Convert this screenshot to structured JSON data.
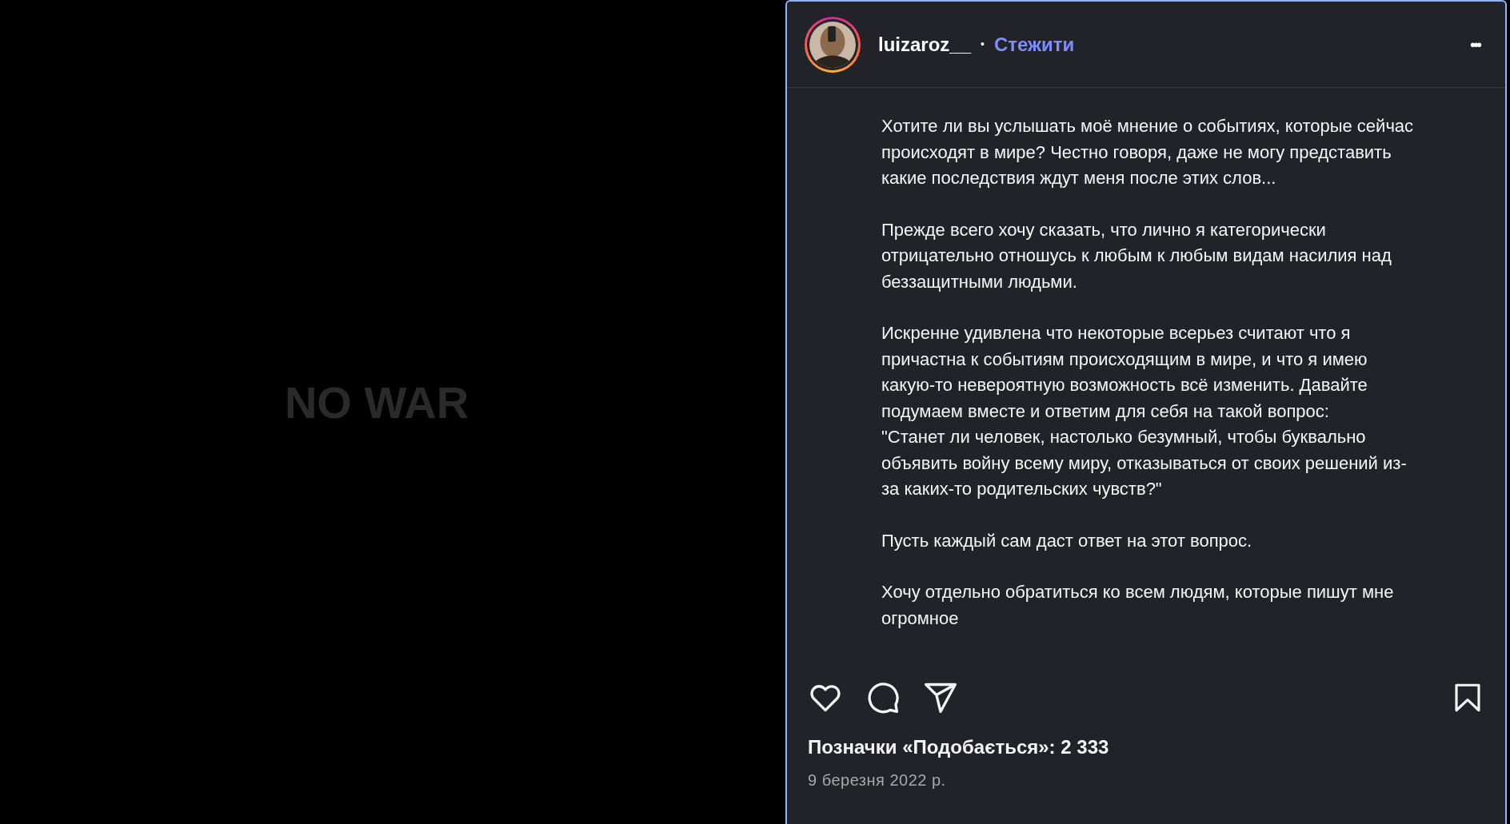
{
  "post_image": {
    "text": "NO WAR"
  },
  "header": {
    "username": "luizaroz__",
    "separator": "•",
    "follow": "Стежити",
    "more": "•••"
  },
  "caption": [
    "Хотите ли вы услышать моё мнение о событиях, которые сейчас происходят в мире? Честно говоря, даже не могу представить какие последствия ждут меня после этих слов...",
    "Прежде всего хочу сказать, что лично я категорически отрицательно отношусь к любым к любым видам насилия над беззащитными людьми.",
    "Искренне удивлена что некоторые всерьез считают что я причастна к событиям происходящим в мире, и что я имею какую-то невероятную возможность всё изменить. Давайте подумаем вместе и ответим для себя на такой вопрос:\n\"Станет ли человек, настолько безумный, чтобы буквально объявить войну всему миру, отказываться от своих решений из-за каких-то родительских чувств?\"",
    "Пусть каждый сам даст ответ на этот вопрос.",
    "Хочу отдельно обратиться ко всем людям, которые пишут мне огромное"
  ],
  "actions": {
    "liked": false,
    "saved": false
  },
  "likes": "Позначки «Подобається»: 2 333",
  "date": "9 березня 2022 р."
}
